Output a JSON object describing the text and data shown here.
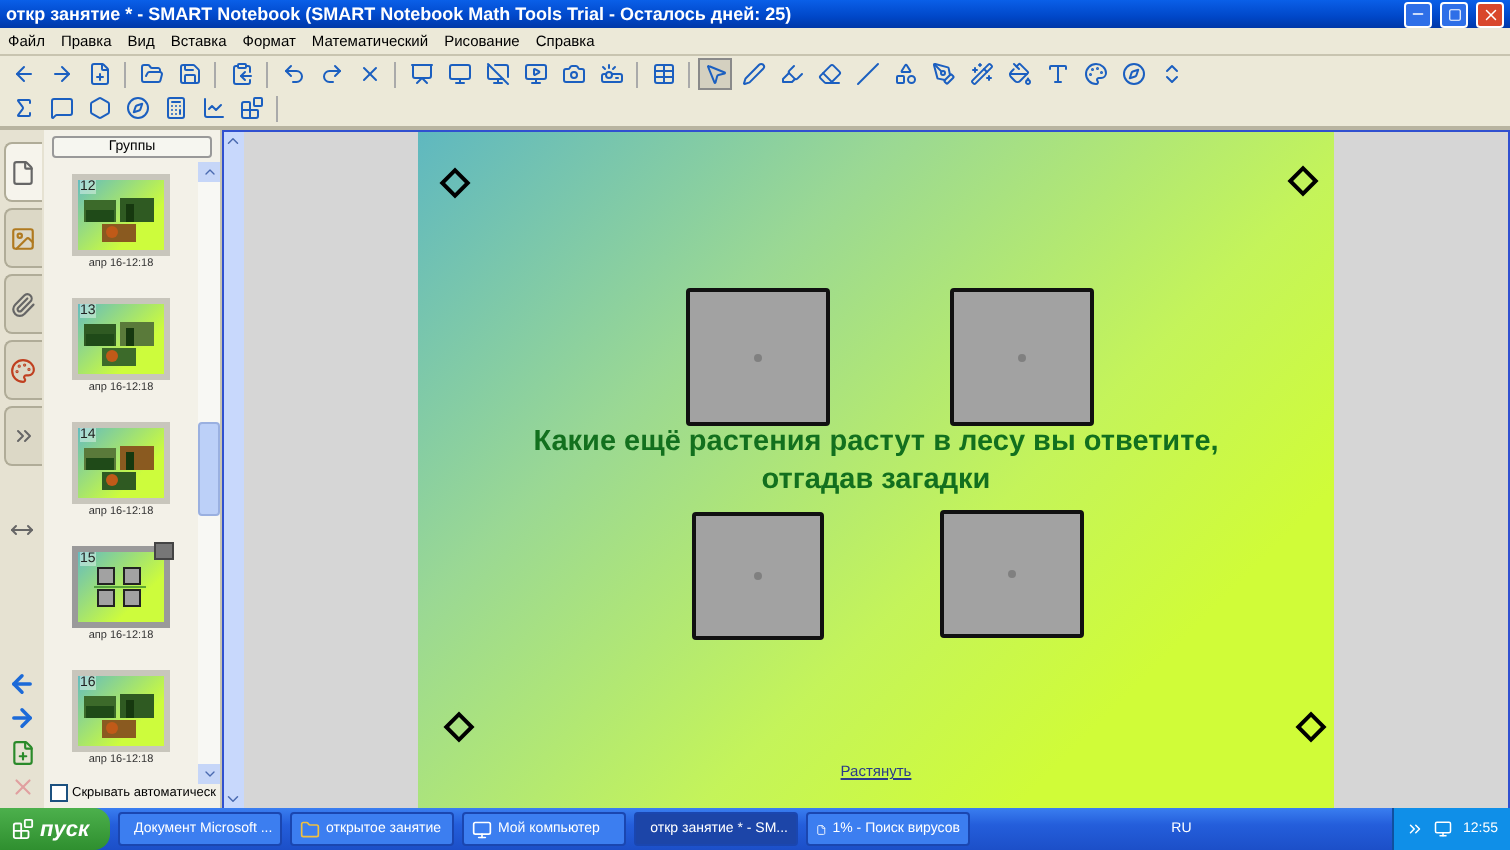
{
  "window": {
    "title": "откр занятие * - SMART Notebook (SMART Notebook Math Tools Trial - Осталось дней: 25)"
  },
  "menu": [
    "Файл",
    "Правка",
    "Вид",
    "Вставка",
    "Формат",
    "Математический",
    "Рисование",
    "Справка"
  ],
  "toolbar": {
    "row_1": [
      {
        "selected": false
      },
      {
        "selected": false
      },
      {
        "selected": false
      },
      {
        "selected": false
      },
      {
        "selected": false
      },
      {
        "selected": false
      },
      {
        "selected": false
      },
      {
        "selected": false
      },
      {
        "selected": false
      },
      {
        "selected": false
      },
      {
        "selected": false
      },
      {
        "selected": false
      },
      {
        "selected": false
      },
      {
        "selected": false
      },
      {
        "selected": false
      },
      {
        "selected": false
      },
      {
        "selected": true
      },
      {
        "selected": false
      },
      {
        "selected": false
      },
      {
        "selected": false
      },
      {
        "selected": false
      },
      {
        "selected": false
      },
      {
        "selected": false
      },
      {
        "selected": false
      },
      {
        "selected": false
      },
      {
        "selected": false
      },
      {
        "selected": false
      },
      {
        "selected": false
      },
      {
        "selected": false
      }
    ],
    "row_2": [
      {
        "selected": false
      },
      {
        "selected": false
      },
      {
        "selected": false
      },
      {
        "selected": false
      },
      {
        "selected": false
      },
      {
        "selected": false
      },
      {
        "selected": false
      }
    ]
  },
  "side_panel": {
    "groups_button": "Группы",
    "pages": [
      {
        "number": "12",
        "date": "апр 16-12:18",
        "kind": "photos",
        "selected": false
      },
      {
        "number": "13",
        "date": "апр 16-12:18",
        "kind": "photos",
        "selected": false
      },
      {
        "number": "14",
        "date": "апр 16-12:18",
        "kind": "photos",
        "selected": false
      },
      {
        "number": "15",
        "date": "апр 16-12:18",
        "kind": "squares",
        "selected": true
      },
      {
        "number": "16",
        "date": "апр 16-12:18",
        "kind": "photos",
        "selected": false
      }
    ],
    "auto_hide": {
      "label": "Скрывать автоматическ",
      "checked": false
    }
  },
  "page": {
    "question": "Какие ещё растения растут в лесу вы ответите, отгадав загадки",
    "link": "Растянуть"
  },
  "taskbar": {
    "start": "пуск",
    "tasks": [
      {
        "label": "Документ Microsoft ...",
        "selected": false
      },
      {
        "label": "открытое занятие",
        "selected": false
      },
      {
        "label": "Мой компьютер",
        "selected": false
      },
      {
        "label": "откр занятие * - SM...",
        "selected": true
      },
      {
        "label": "1% - Поиск вирусов",
        "selected": false
      }
    ],
    "language": "RU",
    "clock": "12:55"
  }
}
